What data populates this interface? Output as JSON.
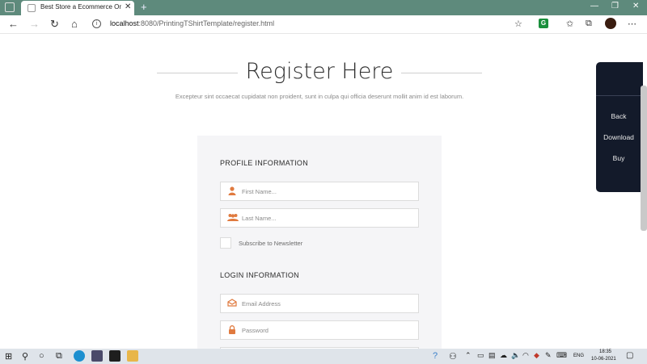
{
  "browser": {
    "tab_title": "Best Store a Ecommerce Online",
    "tab_close": "✕",
    "new_tab": "+",
    "url_host": "localhost",
    "url_path": ":8080/PrintingTShirtTemplate/register.html",
    "ext_badge": "G"
  },
  "page": {
    "title": "Register Here",
    "subtitle": "Excepteur sint occaecat cupidatat non proident, sunt in culpa qui officia deserunt mollit anim id est laborum.",
    "profile_section": "PROFILE INFORMATION",
    "first_name_placeholder": "First Name...",
    "last_name_placeholder": "Last Name...",
    "newsletter_label": "Subscribe to Newsletter",
    "login_section": "LOGIN INFORMATION",
    "email_placeholder": "Email Address",
    "password_placeholder": "Password"
  },
  "side_panel": {
    "back": "Back",
    "download": "Download",
    "buy": "Buy"
  },
  "taskbar": {
    "language": "ENG",
    "time": "18:35",
    "date": "10-06-2021"
  },
  "colors": {
    "accent_icon": "#e07a3f",
    "side_panel_bg": "#131a2a",
    "chrome_green": "#5e8a7c"
  }
}
